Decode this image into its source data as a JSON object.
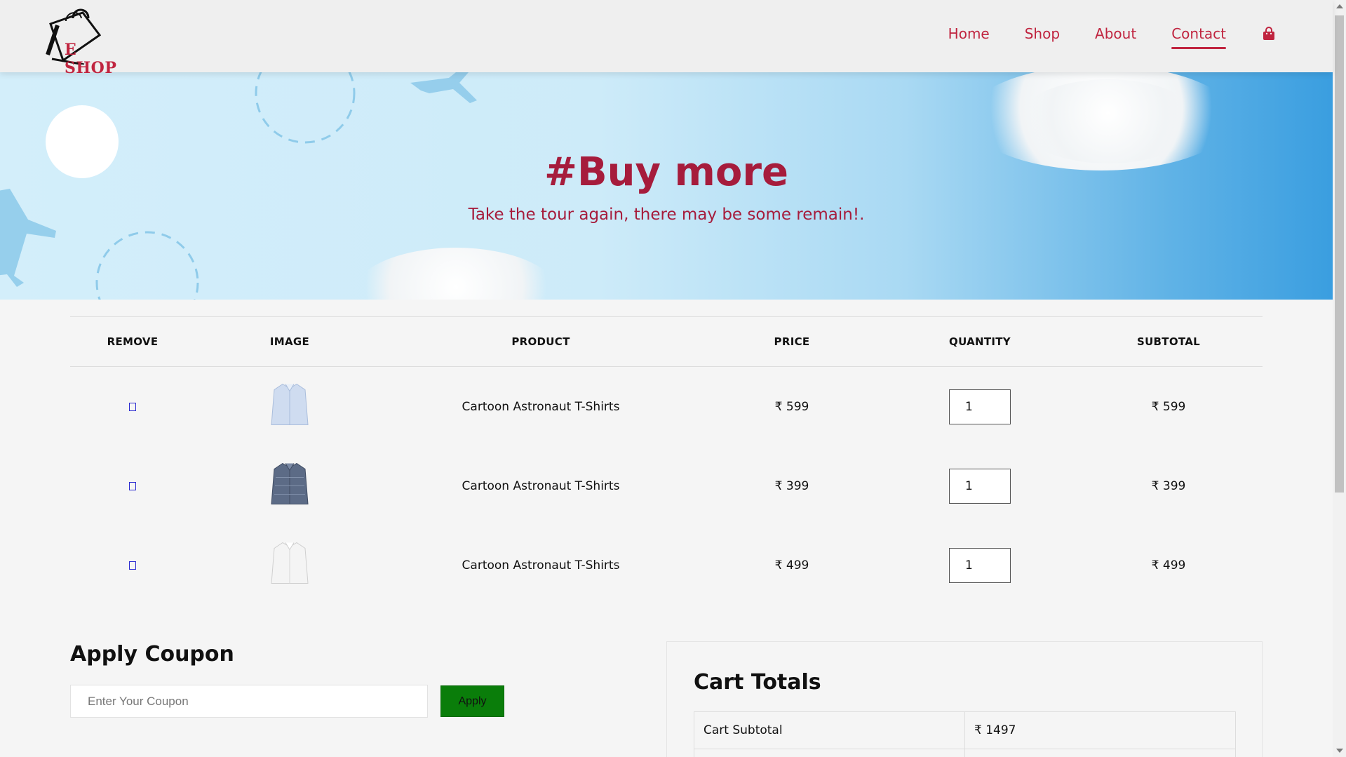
{
  "brand": {
    "logo_text": "E SHOP"
  },
  "nav": {
    "items": [
      {
        "label": "Home",
        "active": false
      },
      {
        "label": "Shop",
        "active": false
      },
      {
        "label": "About",
        "active": false
      },
      {
        "label": "Contact",
        "active": true
      }
    ],
    "cart_icon": "shopping-bag-icon"
  },
  "hero": {
    "title": "#Buy more",
    "subtitle": "Take the tour again, there may be some remain!."
  },
  "cart": {
    "columns": [
      "REMOVE",
      "IMAGE",
      "PRODUCT",
      "PRICE",
      "QUANTITY",
      "SUBTOTAL"
    ],
    "rows": [
      {
        "remove_icon": "remove-icon",
        "image_icon": "light-blue-shirt",
        "product": "Cartoon Astronaut T-Shirts",
        "price": "₹ 599",
        "quantity": "1",
        "subtotal": "₹ 599"
      },
      {
        "remove_icon": "remove-icon",
        "image_icon": "navy-check-shirt",
        "product": "Cartoon Astronaut T-Shirts",
        "price": "₹ 399",
        "quantity": "1",
        "subtotal": "₹ 399"
      },
      {
        "remove_icon": "remove-icon",
        "image_icon": "white-shirt",
        "product": "Cartoon Astronaut T-Shirts",
        "price": "₹ 499",
        "quantity": "1",
        "subtotal": "₹ 499"
      }
    ]
  },
  "coupon": {
    "title": "Apply Coupon",
    "placeholder": "Enter Your Coupon",
    "button_label": "Apply"
  },
  "totals": {
    "title": "Cart Totals",
    "rows": [
      {
        "label": "Cart Subtotal",
        "value": "₹ 1497"
      }
    ]
  },
  "colors": {
    "brand": "#c0243f",
    "hero_text": "#a61c3c",
    "apply_button": "#0a7d0a"
  }
}
